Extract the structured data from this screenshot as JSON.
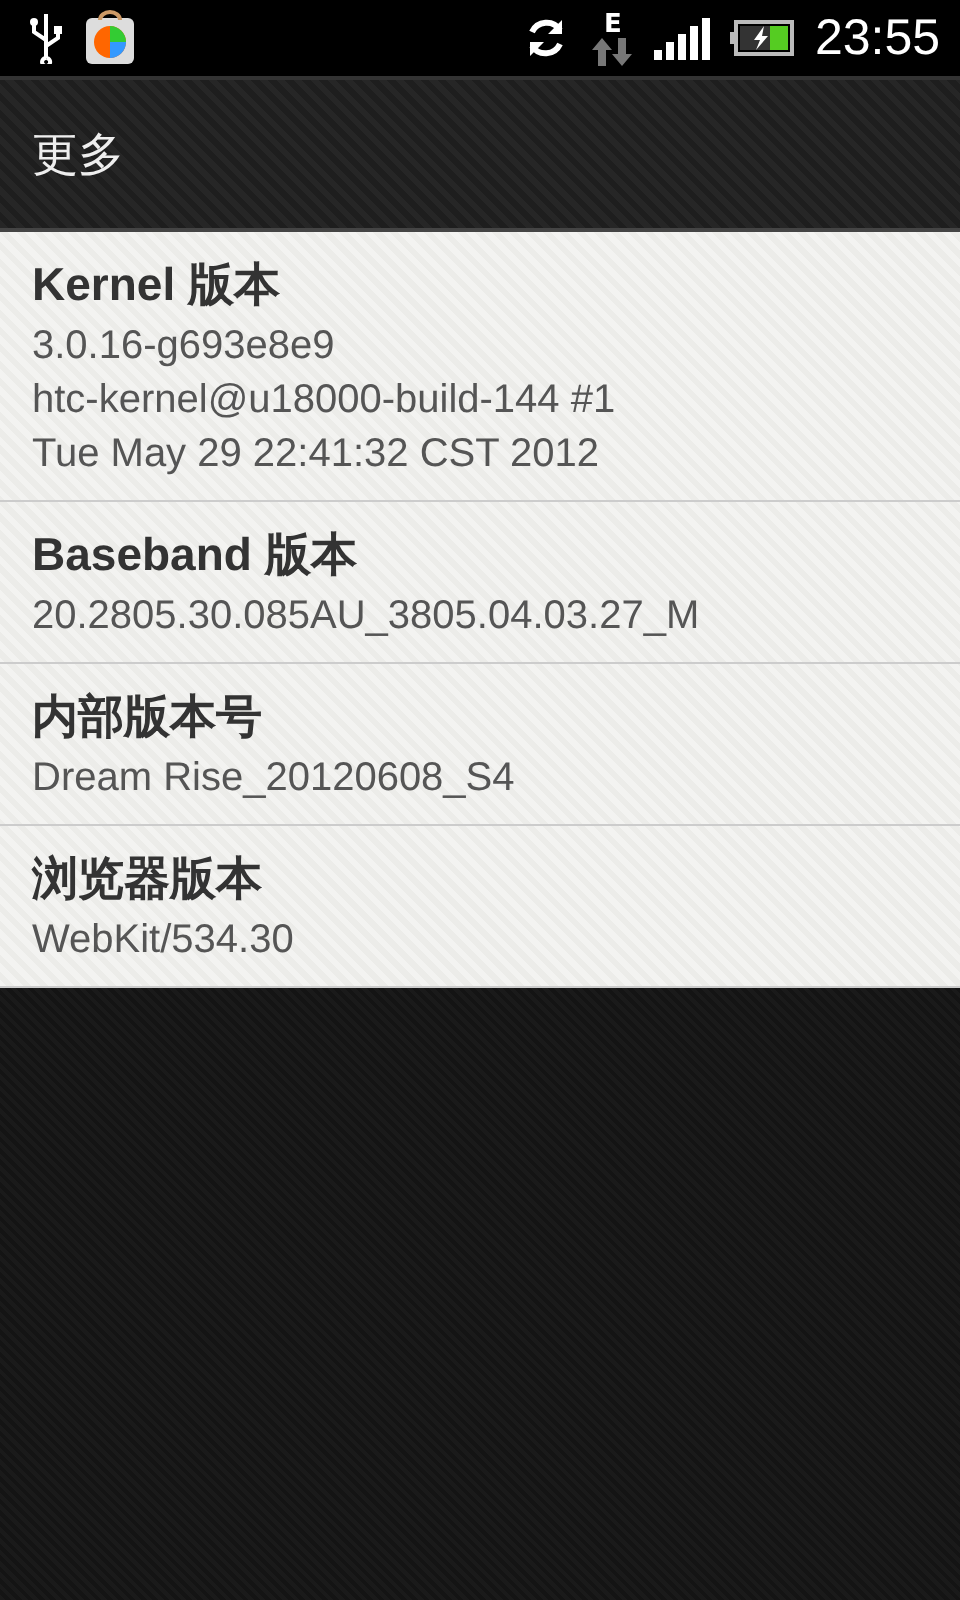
{
  "status_bar": {
    "network": "E",
    "time": "23:55"
  },
  "header": {
    "title": "更多"
  },
  "items": [
    {
      "title": "Kernel 版本",
      "lines": [
        "3.0.16-g693e8e9",
        "htc-kernel@u18000-build-144 #1",
        "Tue May 29 22:41:32 CST 2012"
      ]
    },
    {
      "title": "Baseband 版本",
      "lines": [
        "20.2805.30.085AU_3805.04.03.27_M"
      ]
    },
    {
      "title": "内部版本号",
      "lines": [
        "Dream Rise_20120608_S4"
      ]
    },
    {
      "title": "浏览器版本",
      "lines": [
        "WebKit/534.30"
      ]
    }
  ]
}
